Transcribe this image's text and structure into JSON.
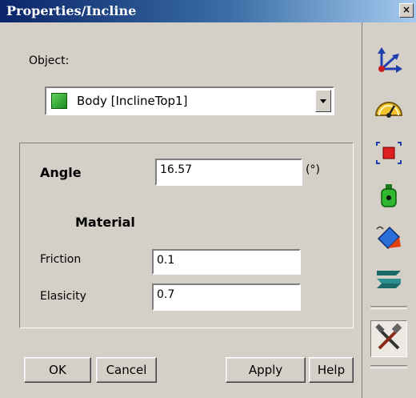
{
  "window": {
    "title": "Properties/Incline",
    "close_label": "×"
  },
  "object": {
    "label": "Object:",
    "selected_value": "Body  [InclineTop1]"
  },
  "angle": {
    "label": "Angle",
    "value": "16.57",
    "unit": "(°)"
  },
  "material": {
    "heading": "Material",
    "friction_label": "Friction",
    "friction_value": "0.1",
    "elasticity_label": "Elasicity",
    "elasticity_value": "0.7"
  },
  "buttons": {
    "ok": "OK",
    "cancel": "Cancel",
    "apply": "Apply",
    "help": "Help"
  },
  "toolbar": {
    "tools": [
      "axes-icon",
      "gauge-icon",
      "selection-box-icon",
      "mass-weight-icon",
      "paint-bucket-icon",
      "spring-icon",
      "tools-icon"
    ],
    "active_tool": "tools-icon"
  }
}
